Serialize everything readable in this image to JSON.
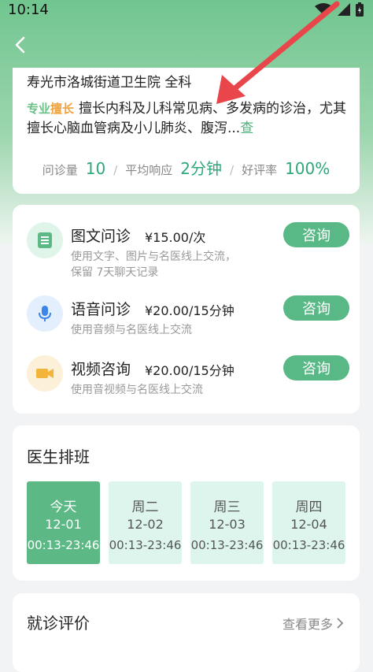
{
  "status": {
    "time": "10:14"
  },
  "doctor": {
    "hospital": "寿光市洛城街道卫生院 全科",
    "badge_part1": "专业",
    "badge_part2": "擅长",
    "specialty_text": "擅长内科及儿科常见病、多发病的诊治，尤其擅长心脑血管病及小儿肺炎、腹泻...",
    "more_label": "查",
    "stats": [
      {
        "label": "问诊量",
        "value": "10"
      },
      {
        "label": "平均响应",
        "value": "2分钟"
      },
      {
        "label": "好评率",
        "value": "100%"
      }
    ]
  },
  "services": [
    {
      "title": "图文问诊",
      "price": "¥15.00/次",
      "desc": "使用文字、图片与名医线上交流，保留 7天聊天记录",
      "button": "咨询",
      "icon": "chat-icon",
      "icon_bg": "#dff5ea",
      "icon_color": "#5cb985"
    },
    {
      "title": "语音问诊",
      "price": "¥20.00/15分钟",
      "desc": "使用音频与名医线上交流",
      "button": "咨询",
      "icon": "microphone-icon",
      "icon_bg": "#e3effd",
      "icon_color": "#3d86e8"
    },
    {
      "title": "视频咨询",
      "price": "¥20.00/15分钟",
      "desc": "使用音视频与名医线上交流",
      "button": "咨询",
      "icon": "video-camera-icon",
      "icon_bg": "#fdf0d9",
      "icon_color": "#f2b43a"
    }
  ],
  "schedule": {
    "title": "医生排班",
    "days": [
      {
        "day": "今天",
        "date": "12-01",
        "time": "00:13-23:46",
        "active": true
      },
      {
        "day": "周二",
        "date": "12-02",
        "time": "00:13-23:46",
        "active": false
      },
      {
        "day": "周三",
        "date": "12-03",
        "time": "00:13-23:46",
        "active": false
      },
      {
        "day": "周四",
        "date": "12-04",
        "time": "00:13-23:46",
        "active": false
      }
    ]
  },
  "reviews": {
    "title": "就诊评价",
    "more": "查看更多"
  },
  "colors": {
    "accent": "#5cb985",
    "arrow": "#e8464a"
  }
}
